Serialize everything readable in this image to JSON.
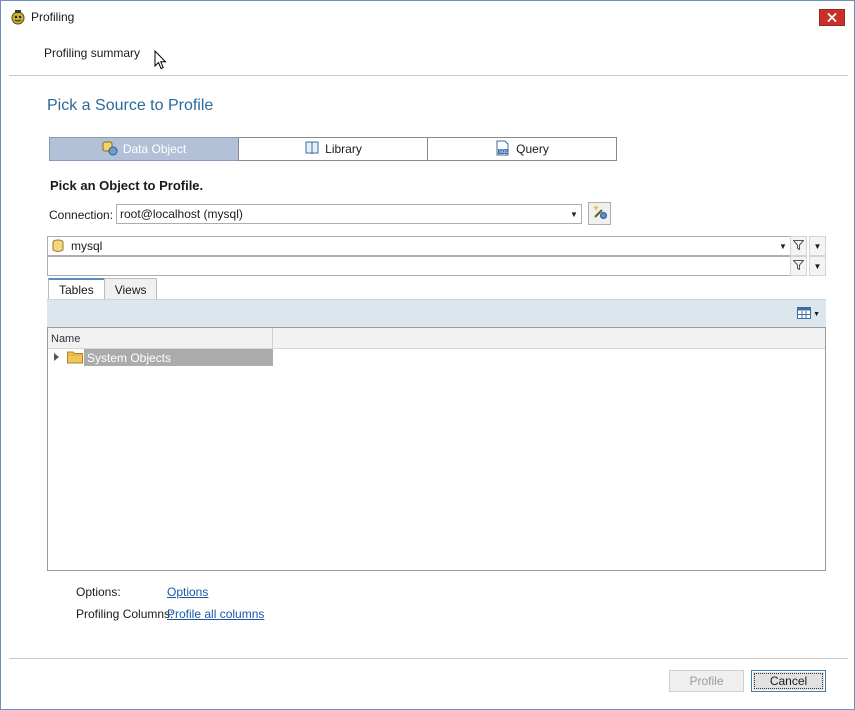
{
  "window": {
    "title": "Profiling"
  },
  "header": {
    "summary_label": "Profiling summary"
  },
  "page": {
    "heading": "Pick a Source to Profile",
    "section_title": "Pick an Object to Profile."
  },
  "source_tabs": [
    {
      "label": "Data Object",
      "icon": "data-object-icon",
      "active": true
    },
    {
      "label": "Library",
      "icon": "library-book-icon",
      "active": false
    },
    {
      "label": "Query",
      "icon": "sql-query-icon",
      "active": false
    }
  ],
  "connection": {
    "label": "Connection:",
    "value": "root@localhost (mysql)"
  },
  "database": {
    "value": "mysql",
    "filter_value": ""
  },
  "object_tabs": [
    {
      "label": "Tables",
      "active": true
    },
    {
      "label": "Views",
      "active": false
    }
  ],
  "grid": {
    "columns": [
      "Name"
    ],
    "rows": [
      {
        "label": "System Objects",
        "icon": "folder-icon",
        "expanded": false
      }
    ]
  },
  "options": {
    "options_label": "Options:",
    "options_link": "Options",
    "columns_label": "Profiling Columns:",
    "columns_link": "Profile all columns"
  },
  "buttons": {
    "profile": "Profile",
    "cancel": "Cancel"
  },
  "colors": {
    "heading": "#2b6a98",
    "active_tab": "#b3c1d8",
    "link": "#1a57a8",
    "close_button": "#c9302c",
    "toolbar": "#dbe6ef"
  }
}
